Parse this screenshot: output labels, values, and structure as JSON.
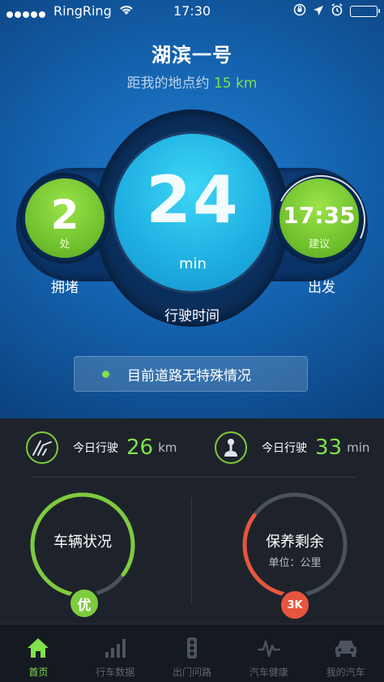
{
  "status_bar": {
    "carrier": "RingRing",
    "time": "17:30"
  },
  "header": {
    "title": "湖滨一号",
    "distance_prefix": "距我的地点约",
    "distance_value": "15 km"
  },
  "cluster": {
    "drive_time_value": "24",
    "drive_time_unit": "min",
    "drive_time_label": "行驶时间",
    "congestion_value": "2",
    "congestion_unit": "处",
    "congestion_label": "拥堵",
    "depart_time": "17:35",
    "depart_sub": "建议",
    "depart_label": "出发"
  },
  "notice": {
    "text": "目前道路无特殊情况",
    "dot_color": "#7ee24a"
  },
  "stats": {
    "today_distance_label": "今日行驶",
    "today_distance_value": "26",
    "today_distance_unit": "km",
    "today_time_label": "今日行驶",
    "today_time_value": "33",
    "today_time_unit": "min"
  },
  "gauges": {
    "vehicle": {
      "title": "车辆状况",
      "badge": "优",
      "color": "#7ecb3e",
      "level": 0.85
    },
    "maintenance": {
      "title": "保养剩余",
      "sub": "单位：公里",
      "badge": "3K",
      "color": "#e8553e",
      "level": 0.35
    }
  },
  "tabs": [
    {
      "label": "首页",
      "icon": "home-icon",
      "active": true
    },
    {
      "label": "行车数据",
      "icon": "bar-chart-icon",
      "active": false
    },
    {
      "label": "出门问路",
      "icon": "traffic-light-icon",
      "active": false
    },
    {
      "label": "汽车健康",
      "icon": "pulse-icon",
      "active": false
    },
    {
      "label": "我的汽车",
      "icon": "car-icon",
      "active": false
    }
  ],
  "colors": {
    "accent_green": "#7ee24a",
    "accent_cyan": "#1fb1e3",
    "accent_red": "#e8553e",
    "bg_blue": "#1462ae",
    "bg_dark": "#1e232b"
  }
}
